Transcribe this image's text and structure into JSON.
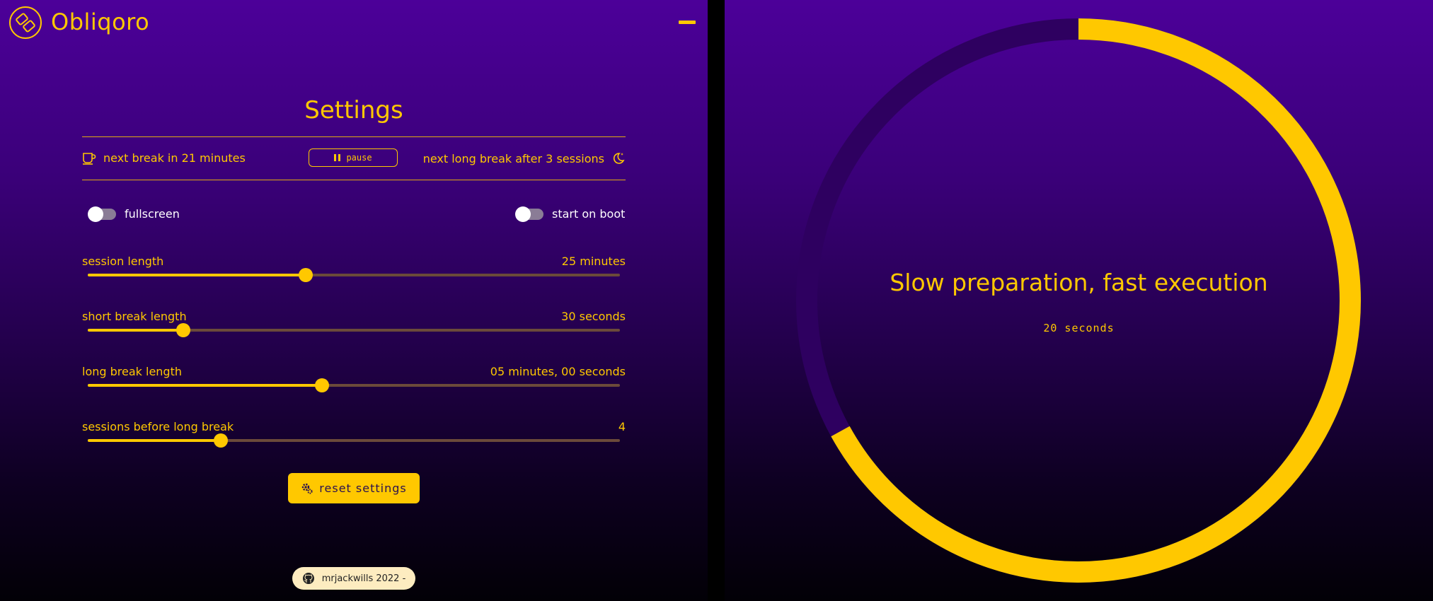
{
  "app": {
    "title": "Obliqoro"
  },
  "settings": {
    "title": "Settings",
    "next_break": "next break in 21 minutes",
    "pause_label": "pause",
    "next_long_break": "next long break after 3 sessions",
    "toggles": [
      {
        "label": "fullscreen",
        "on": false
      },
      {
        "label": "start on boot",
        "on": false
      }
    ],
    "sliders": [
      {
        "label": "session length",
        "value_text": "25 minutes",
        "fraction": 0.41
      },
      {
        "label": "short break length",
        "value_text": "30 seconds",
        "fraction": 0.18
      },
      {
        "label": "long break length",
        "value_text": "05 minutes, 00 seconds",
        "fraction": 0.44
      },
      {
        "label": "sessions before long break",
        "value_text": "4",
        "fraction": 0.25
      }
    ],
    "reset_label": "reset settings"
  },
  "footer": {
    "text": "mrjackwills 2022 -"
  },
  "break_screen": {
    "quote": "Slow preparation, fast execution",
    "countdown": "20 seconds",
    "progress_remaining": 0.67
  },
  "colors": {
    "accent": "#ffc800",
    "track": "#6b4a3a",
    "ring_background": "#2e0060",
    "footer_bg": "#fdecc0"
  },
  "icons": {
    "logo": "obliqoro-logo-icon",
    "coffee": "coffee-cup-icon",
    "moon": "moon-stars-icon",
    "pause": "pause-icon",
    "gear": "gears-icon",
    "github": "github-icon"
  }
}
